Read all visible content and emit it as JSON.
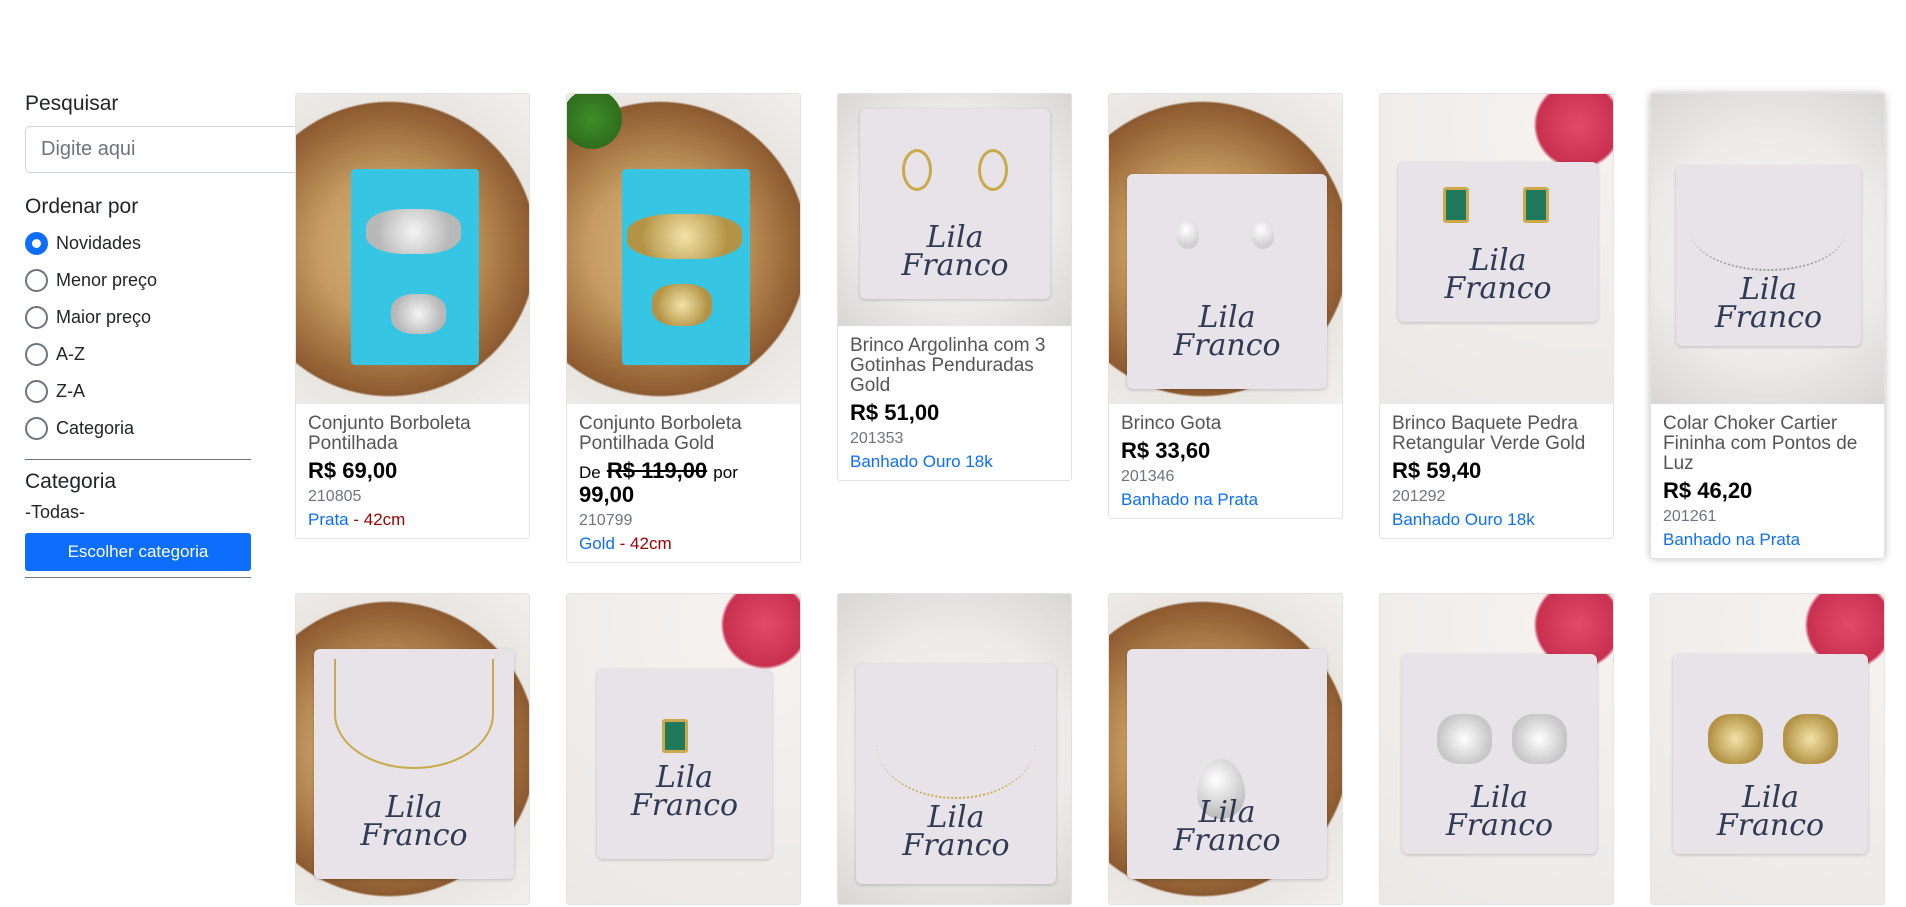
{
  "sidebar": {
    "search_title": "Pesquisar",
    "search_placeholder": "Digite aqui",
    "order_title": "Ordenar por",
    "order_options": [
      "Novidades",
      "Menor preço",
      "Maior preço",
      "A-Z",
      "Z-A",
      "Categoria"
    ],
    "selected_order": "Novidades",
    "category_title": "Categoria",
    "category_value": "-Todas-",
    "category_button": "Escolher categoria"
  },
  "products": [
    {
      "name": "Conjunto Borboleta Pontilhada",
      "price": "R$ 69,00",
      "code": "210805",
      "finish": "Prata",
      "sep": " - ",
      "size": "42cm"
    },
    {
      "name": "Conjunto Borboleta Pontilhada Gold",
      "price_prefix": "De",
      "old_price": "R$ 119,00",
      "price_mid": "por",
      "price": "99,00",
      "code": "210799",
      "finish": "Gold",
      "sep": " - ",
      "size": "42cm"
    },
    {
      "name": "Brinco Argolinha com 3 Gotinhas Penduradas Gold",
      "price": "R$ 51,00",
      "code": "201353",
      "finish": "Banhado Ouro 18k"
    },
    {
      "name": "Brinco Gota",
      "price": "R$ 33,60",
      "code": "201346",
      "finish": "Banhado na Prata"
    },
    {
      "name": "Brinco Baquete Pedra Retangular Verde Gold",
      "price": "R$ 59,40",
      "code": "201292",
      "finish": "Banhado Ouro 18k"
    },
    {
      "name": "Colar Choker Cartier Fininha com Pontos de Luz",
      "price": "R$ 46,20",
      "code": "201261",
      "finish": "Banhado na Prata"
    }
  ],
  "brand_mark": [
    "Lila",
    "Franco"
  ],
  "colors": {
    "accent": "#0d6efd",
    "size_text": "#990000"
  }
}
